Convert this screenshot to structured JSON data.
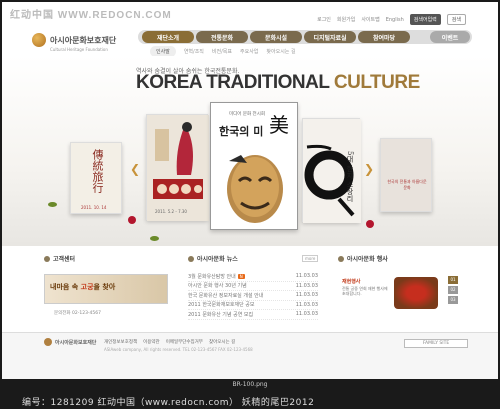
{
  "watermark": "红动中国 WWW.REDOCN.COM",
  "top_links": {
    "items": [
      "로그인",
      "회원가입",
      "사이트맵",
      "English"
    ],
    "search_btn": "검색어입력",
    "search_go": "검색"
  },
  "logo": {
    "name": "아시아문화보호재단",
    "sub": "Cultural Heritage Foundation"
  },
  "nav": [
    "재단소개",
    "전통문화",
    "문화시설",
    "디지털자료실",
    "참여마당",
    "이벤트"
  ],
  "subnav": [
    "인사말",
    "연혁/조직",
    "비전/목표",
    "주요사업",
    "찾아오시는 길"
  ],
  "hero": {
    "subtitle": "역사와 숨결이 살아 숨쉬는 한국전통문화.",
    "title_main": "KOREA TRADITIONAL ",
    "title_accent": "CULTURE"
  },
  "cards": {
    "left2": "傳統旅行",
    "left2_date": "2011. 10. 14",
    "left1_date": "2011. 5.2 - 7.30",
    "center_top": "미디어 문화 전시회",
    "center_title": "한국의 미",
    "center_char": "美",
    "right1": "5대 한지 소장리",
    "right2": "한국의 전통과 아름다운 문화"
  },
  "center_panel": {
    "title": "고객센터",
    "banner": "내마음 속 ",
    "banner_hl": "고궁",
    "banner_end": "을 찾아",
    "info": "문의전화 02-123-4567"
  },
  "news": {
    "title": "아시아문화 뉴스",
    "more": "more",
    "rows": [
      {
        "text": "3월 문화유산탐방 안내",
        "date": "11.03.03",
        "new": "N"
      },
      {
        "text": "아시안 문화 행사 30년 기념",
        "date": "11.03.03",
        "new": ""
      },
      {
        "text": "한국 문화유산 정보자료실 개설 안내",
        "date": "11.03.03",
        "new": ""
      },
      {
        "text": "2011 한국문화재보호재단 공모",
        "date": "11.03.03",
        "new": ""
      },
      {
        "text": "2011 문화유산 기념 공연 모집",
        "date": "11.03.03",
        "new": ""
      }
    ]
  },
  "event": {
    "title": "아시아문화 행사",
    "name": "재현행사",
    "desc": "전통 궁중 연회 재현 행사에 초대합니다.",
    "pages": [
      "01",
      "02",
      "03"
    ]
  },
  "footer": {
    "logo": "아시아문화보호재단",
    "links": [
      "개인정보보호정책",
      "이용약관",
      "이메일무단수집거부",
      "찾아오시는 길"
    ],
    "copy": "ASIAweb company, All rights reserved. TEL 02-123-4567 FAX 02-123-4568",
    "family": "FAMILY SITE"
  },
  "file_name": "BR-100.png",
  "caption": "编号：1281209   红动中国（www.redocn.com）   妖精的尾巴2012"
}
